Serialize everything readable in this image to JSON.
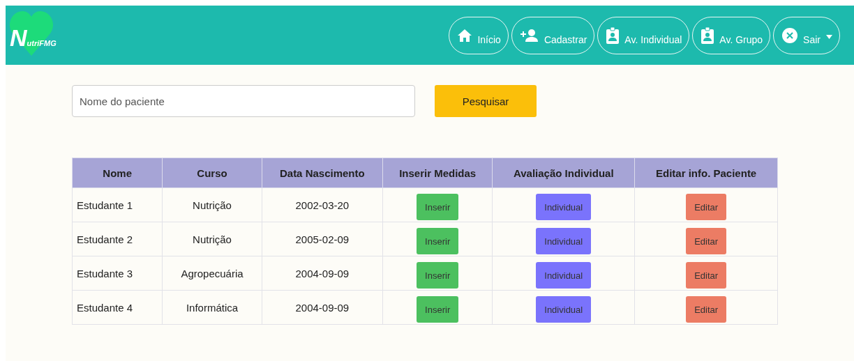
{
  "logo": {
    "initial": "N",
    "rest": "utriFMG"
  },
  "nav": [
    {
      "label": "Início",
      "kind": "home"
    },
    {
      "label": "Cadastrar",
      "kind": "register"
    },
    {
      "label": "Av. Individual",
      "kind": "individual"
    },
    {
      "label": "Av. Grupo",
      "kind": "group"
    },
    {
      "label": "Sair",
      "kind": "exit",
      "dropdown": true
    }
  ],
  "search": {
    "placeholder": "Nome do paciente",
    "button": "Pesquisar"
  },
  "table": {
    "columns": [
      "Nome",
      "Curso",
      "Data Nascimento",
      "Inserir Medidas",
      "Avaliação Individual",
      "Editar info. Paciente"
    ],
    "rows": [
      {
        "name": "Estudante 1",
        "course": "Nutrição",
        "birth": "2002-03-20",
        "insert": "Inserir",
        "individual": "Individual",
        "edit": "Editar"
      },
      {
        "name": "Estudante 2",
        "course": "Nutrição",
        "birth": "2005-02-09",
        "insert": "Inserir",
        "individual": "Individual",
        "edit": "Editar"
      },
      {
        "name": "Estudante 3",
        "course": "Agropecuária",
        "birth": "2004-09-09",
        "insert": "Inserir",
        "individual": "Individual",
        "edit": "Editar"
      },
      {
        "name": "Estudante 4",
        "course": "Informática",
        "birth": "2004-09-09",
        "insert": "Inserir",
        "individual": "Individual",
        "edit": "Editar"
      }
    ]
  }
}
